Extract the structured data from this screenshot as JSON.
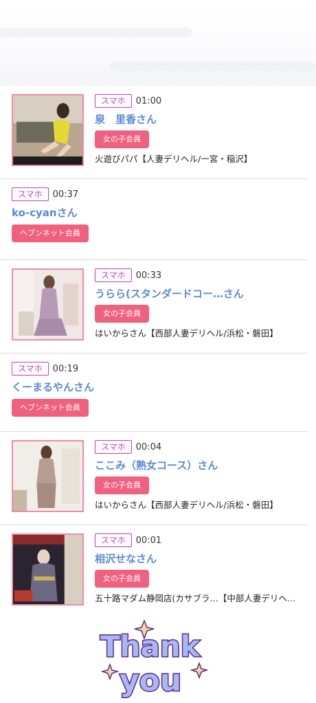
{
  "entries": [
    {
      "device": "スマホ",
      "time": "01:00",
      "name": "泉　里香さん",
      "member": "女の子会員",
      "shop": "火遊びパパ【人妻デリヘル/一宮・稲沢】",
      "thumb": "photo-1"
    },
    {
      "device": "スマホ",
      "time": "00:37",
      "name": "ko-cyanさん",
      "member": "ヘブンネット会員"
    },
    {
      "device": "スマホ",
      "time": "00:33",
      "name": "うらら(スタンダードコー…さん",
      "member": "女の子会員",
      "shop": "はいからさん【西部人妻デリヘル/浜松・磐田】",
      "thumb": "photo-2"
    },
    {
      "device": "スマホ",
      "time": "00:19",
      "name": "くーまるやんさん",
      "member": "ヘブンネット会員"
    },
    {
      "device": "スマホ",
      "time": "00:04",
      "name": "ここみ（熟女コース）さん",
      "member": "女の子会員",
      "shop": "はいからさん【西部人妻デリヘル/浜松・磐田】",
      "thumb": "photo-3"
    },
    {
      "device": "スマホ",
      "time": "00:01",
      "name": "相沢せなさん",
      "member": "女の子会員",
      "shop": "五十路マダム静岡店(カサブラ…【中部人妻デリヘ…",
      "thumb": "photo-4"
    }
  ],
  "footer": {
    "sticker_text": "Thank you"
  }
}
